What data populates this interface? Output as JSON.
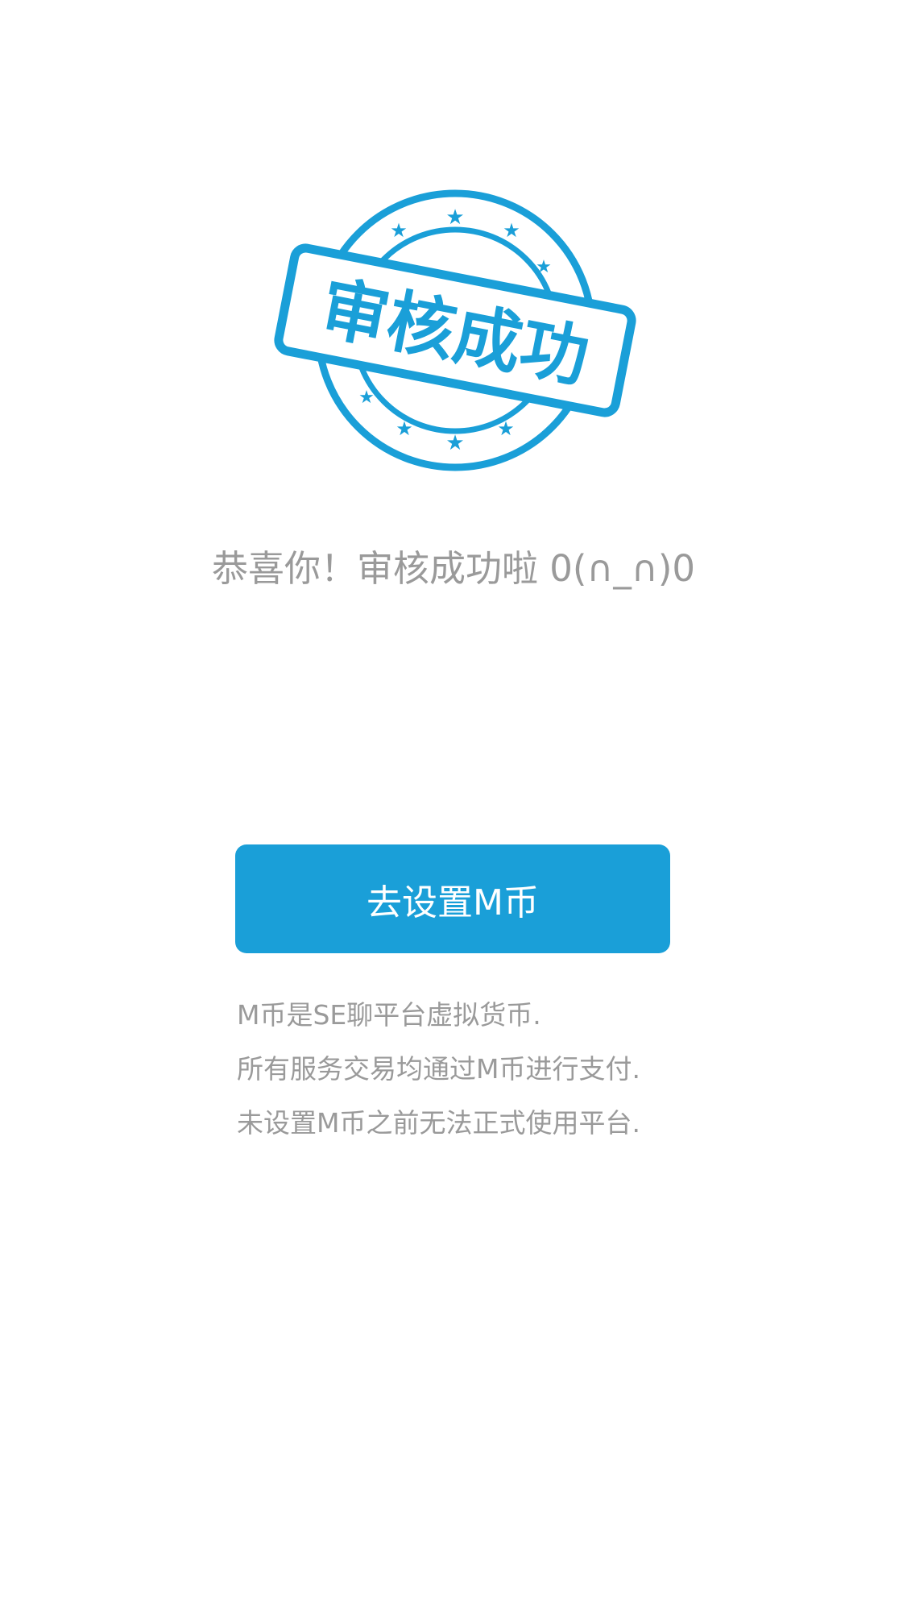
{
  "stamp": {
    "text": "审核成功",
    "color": "#1a9fd8"
  },
  "message": {
    "congrats": "恭喜你！审核成功啦 0(∩_∩)0"
  },
  "action": {
    "button_label": "去设置M币"
  },
  "info": {
    "lines": [
      "M币是SE聊平台虚拟货币.",
      "所有服务交易均通过M币进行支付.",
      "未设置M币之前无法正式使用平台."
    ]
  },
  "colors": {
    "accent": "#1a9fd8",
    "text_muted": "#9a9a9a",
    "background": "#ffffff"
  }
}
